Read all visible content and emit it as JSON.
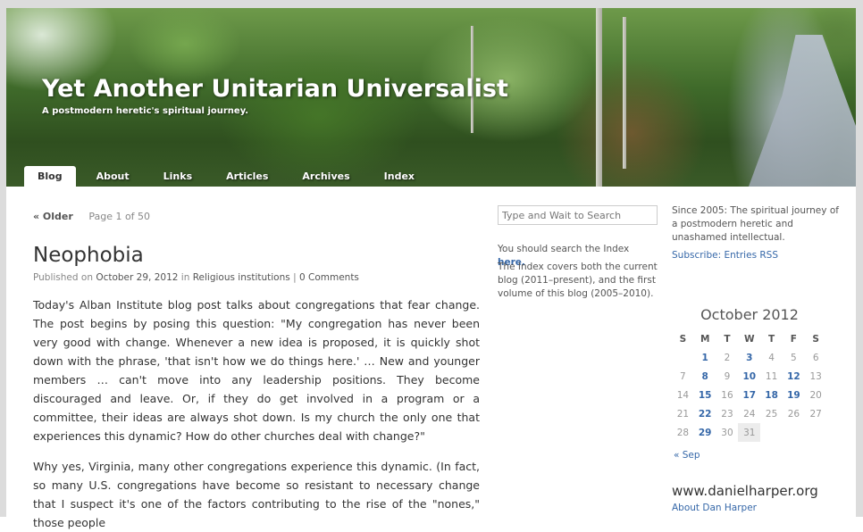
{
  "header": {
    "title": "Yet Another Unitarian Universalist",
    "tagline": "A postmodern heretic's spiritual journey."
  },
  "nav": {
    "items": [
      {
        "label": "Blog",
        "active": true
      },
      {
        "label": "About"
      },
      {
        "label": "Links"
      },
      {
        "label": "Articles"
      },
      {
        "label": "Archives"
      },
      {
        "label": "Index"
      }
    ]
  },
  "pager": {
    "older_label": "« Older",
    "page_text": "Page 1 of 50"
  },
  "post": {
    "title": "Neophobia",
    "meta": {
      "prefix": "Published on",
      "date": "October 29, 2012",
      "in_word": "in",
      "category": "Religious institutions",
      "separator": "|",
      "comments": "0 Comments"
    },
    "paragraphs": [
      "Today's Alban Institute blog post talks about congregations that fear change. The post begins by posing this question: \"My congregation has never been very good with change. Whenever a new idea is proposed, it is quickly shot down with the phrase, 'that isn't how we do things here.' … New and younger members … can't move into any leadership positions. They become discouraged and leave. Or, if they do get involved in a program or a committee, their ideas are always shot down. Is my church the only one that experiences this dynamic? How do other churches deal with change?\"",
      "Why yes, Virginia, many other congregations experience this dynamic. (In fact, so many U.S. congregations have become so resistant to necessary change that I suspect it's one of the factors contributing to the rise of the \"nones,\" those people"
    ]
  },
  "search": {
    "placeholder": "Type and Wait to Search",
    "hint_prefix": "You should search the Index",
    "hint_link": "here.",
    "note": "The Index covers both the current blog (2011–present), and the first volume of this blog (2005–2010)."
  },
  "sidebar": {
    "about_text": "Since 2005: The spiritual journey of a postmodern heretic and unashamed intellectual.",
    "subscribe_label": "Subscribe: Entries RSS",
    "calendar": {
      "caption": "October 2012",
      "weekdays": [
        "S",
        "M",
        "T",
        "W",
        "T",
        "F",
        "S"
      ],
      "weeks": [
        [
          "",
          "1",
          "2",
          "3",
          "4",
          "5",
          "6"
        ],
        [
          "7",
          "8",
          "9",
          "10",
          "11",
          "12",
          "13"
        ],
        [
          "14",
          "15",
          "16",
          "17",
          "18",
          "19",
          "20"
        ],
        [
          "21",
          "22",
          "23",
          "24",
          "25",
          "26",
          "27"
        ],
        [
          "28",
          "29",
          "30",
          "31",
          "",
          "",
          ""
        ]
      ],
      "linked_days": [
        "1",
        "3",
        "8",
        "10",
        "12",
        "15",
        "17",
        "18",
        "19",
        "22",
        "29"
      ],
      "today": "31",
      "prev_label": "« Sep"
    },
    "footer_site": "www.danielharper.org",
    "footer_link": "About Dan Harper"
  },
  "colors": {
    "link": "#3567a8",
    "text": "#333333",
    "muted": "#888888",
    "frame": "#dcdcdc"
  }
}
